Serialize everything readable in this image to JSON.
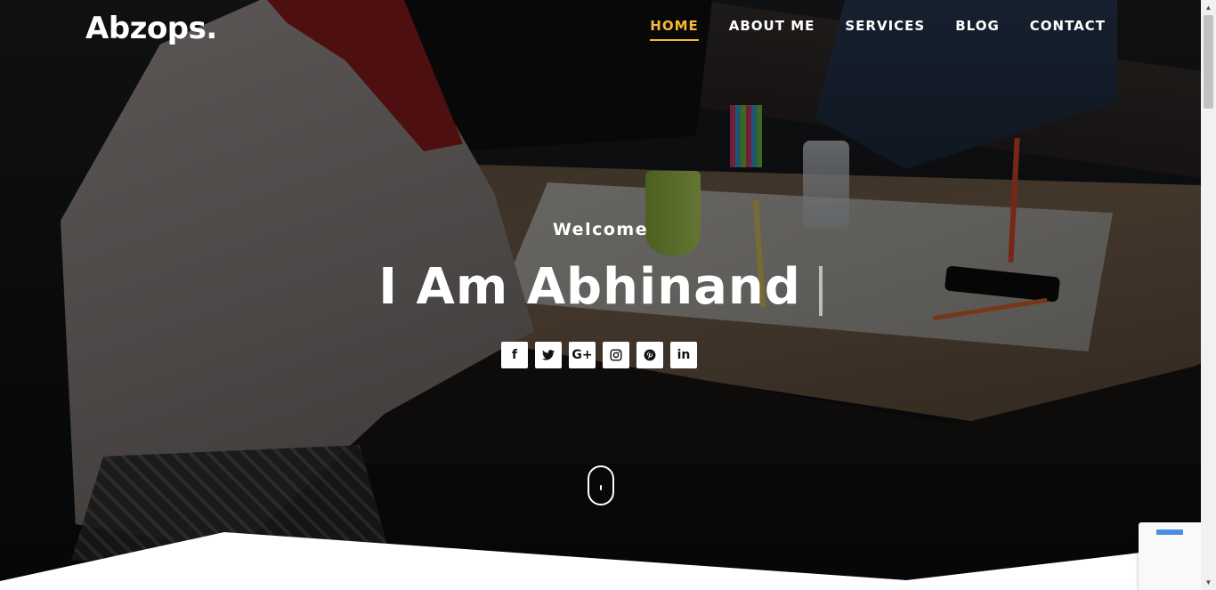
{
  "brand": {
    "logo": "Abzops."
  },
  "nav": {
    "items": [
      {
        "label": "HOME",
        "active": true
      },
      {
        "label": "ABOUT ME",
        "active": false
      },
      {
        "label": "SERVICES",
        "active": false
      },
      {
        "label": "BLOG",
        "active": false
      },
      {
        "label": "CONTACT",
        "active": false
      }
    ]
  },
  "hero": {
    "welcome": "Welcome",
    "headline": "I Am Abhinand"
  },
  "social": [
    {
      "icon": "facebook-icon",
      "glyph": "f"
    },
    {
      "icon": "twitter-icon",
      "glyph": "🐦"
    },
    {
      "icon": "google-plus-icon",
      "glyph": "G+"
    },
    {
      "icon": "instagram-icon",
      "glyph": "◎"
    },
    {
      "icon": "pinterest-icon",
      "glyph": "℗"
    },
    {
      "icon": "linkedin-icon",
      "glyph": "in"
    }
  ],
  "colors": {
    "accent": "#f5b932",
    "nav_text": "#ffffff",
    "divider": "#ffffff"
  }
}
